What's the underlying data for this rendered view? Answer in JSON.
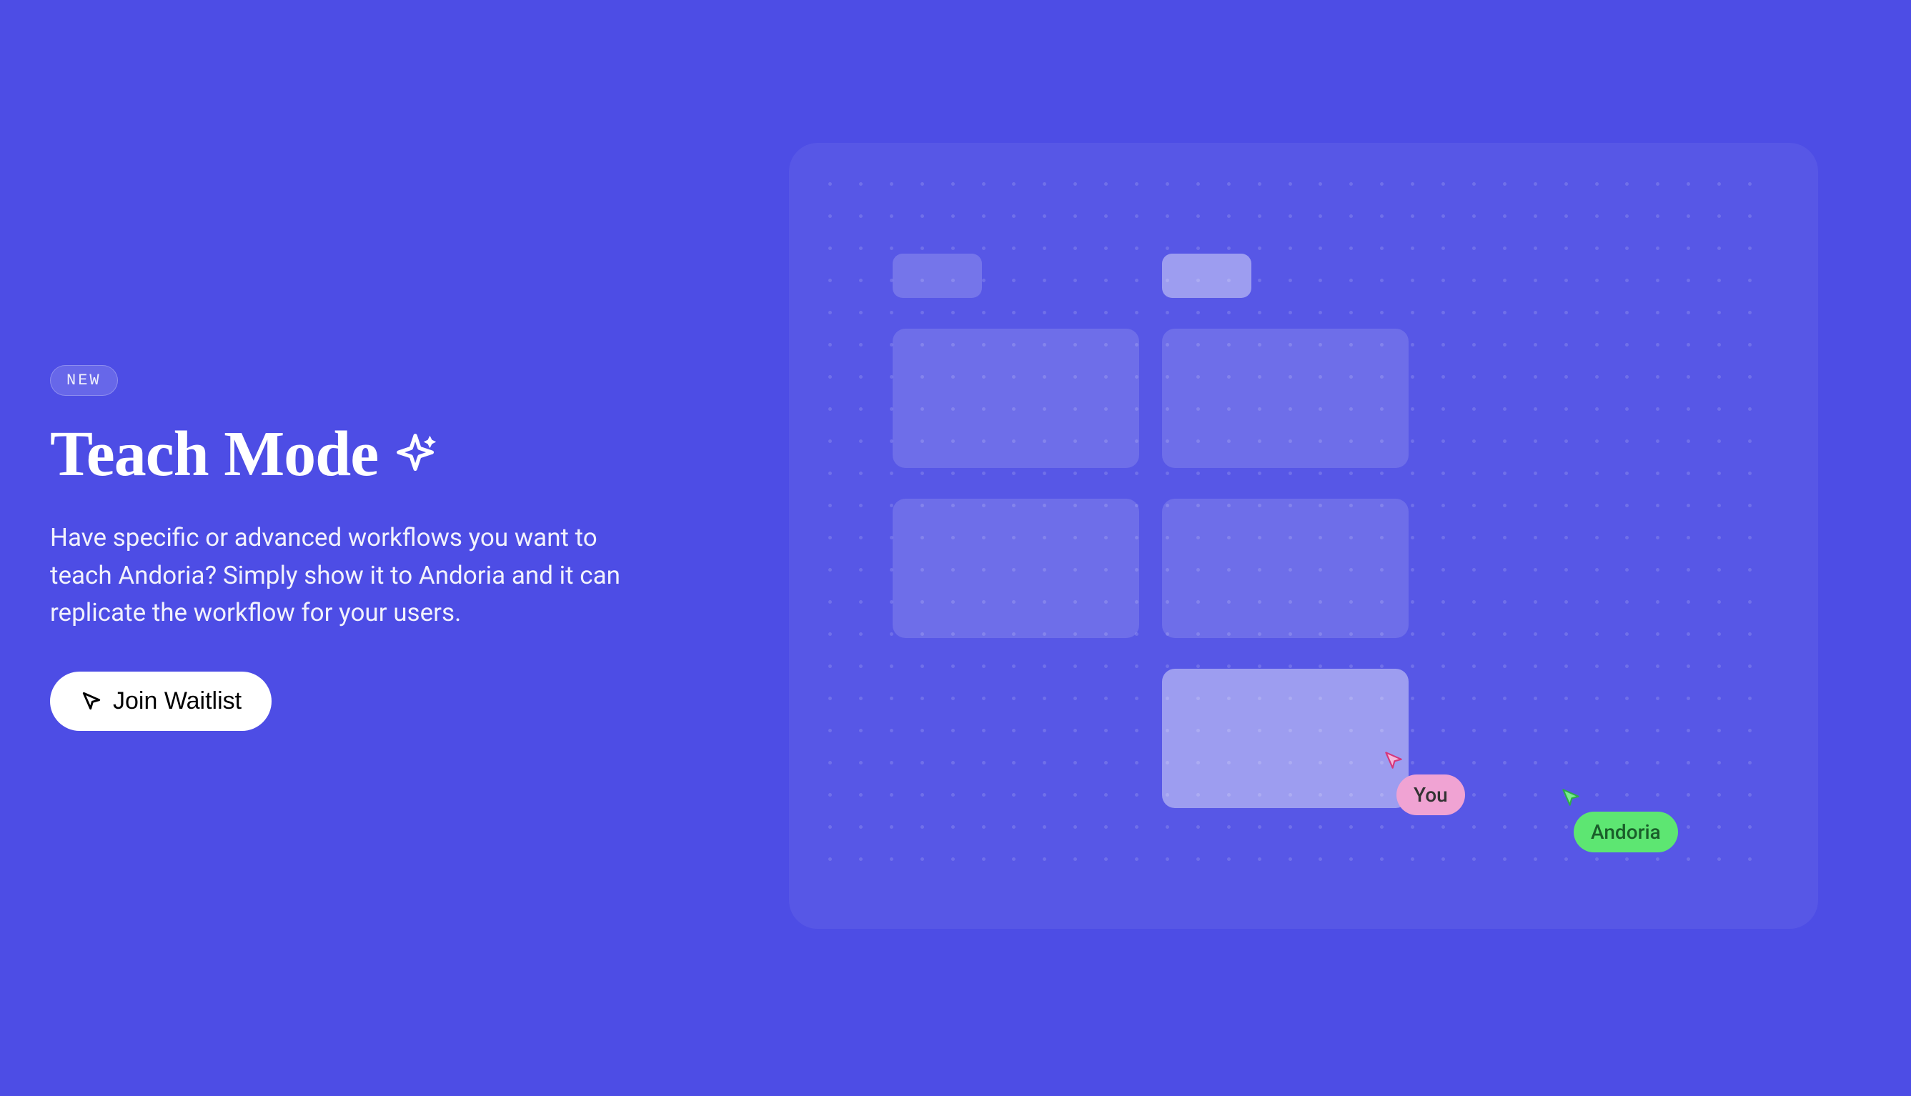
{
  "badge": {
    "label": "NEW"
  },
  "hero": {
    "title": "Teach Mode",
    "description": "Have specific or advanced workflows you want to teach Andoria? Simply show it to Andoria and it can replicate the workflow for your users."
  },
  "cta": {
    "label": "Join Waitlist"
  },
  "illustration": {
    "cursors": {
      "you": "You",
      "andoria": "Andoria"
    }
  }
}
